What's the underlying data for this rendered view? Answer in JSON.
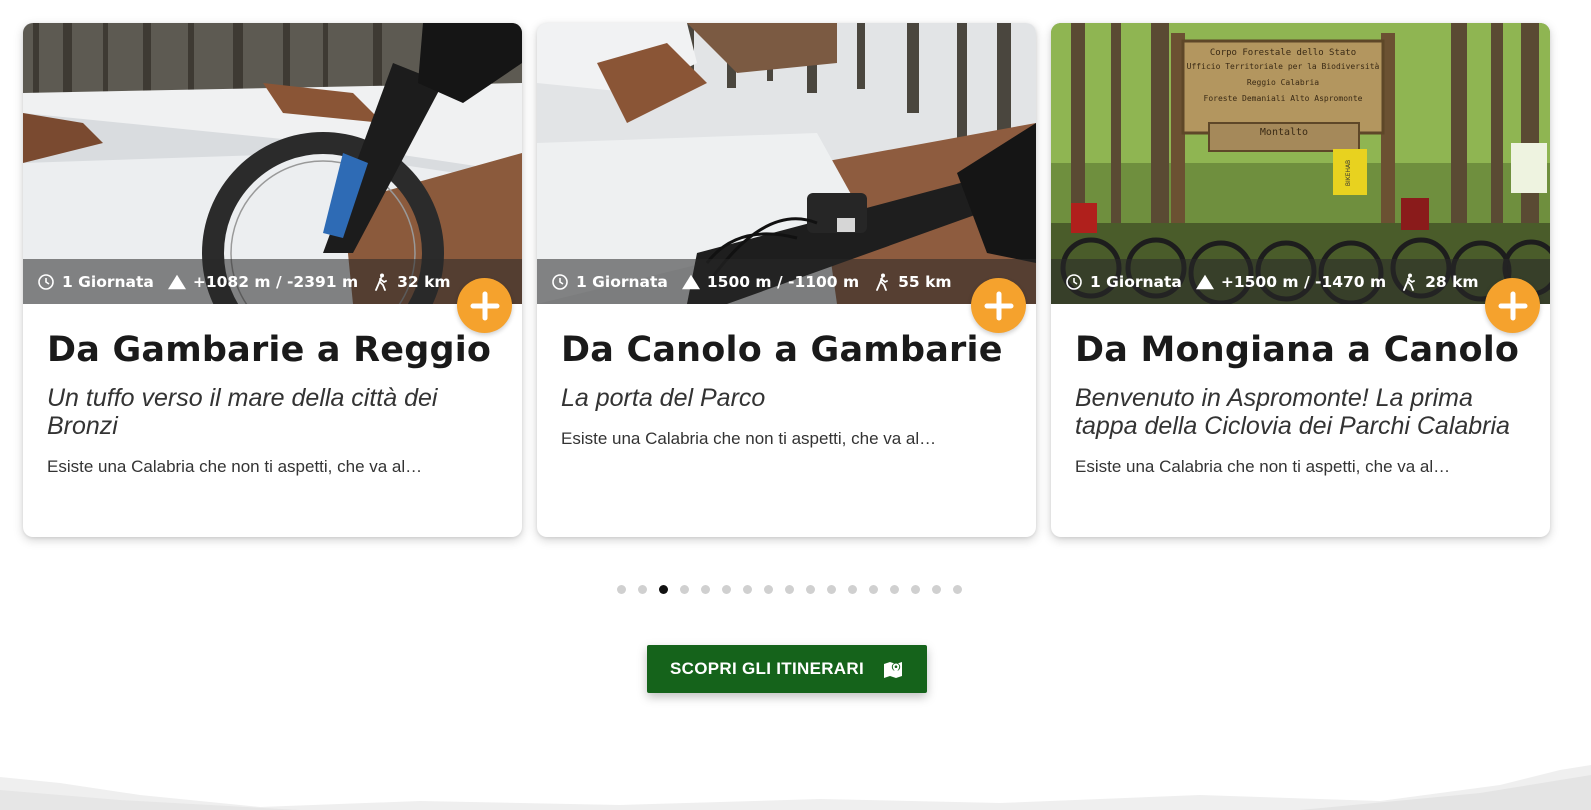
{
  "cards": [
    {
      "duration": "1 Giornata",
      "elevation": "+1082 m / -2391 m",
      "distance": "32 km",
      "title": "Da Gambarie a Reggio",
      "subtitle": "Un tuffo verso il mare della città dei Bronzi",
      "excerpt": "Esiste una Calabria che non ti aspetti, che va al…",
      "photo": "mountain-bike-front-wheel-on-snowy-forest-trail"
    },
    {
      "duration": "1 Giornata",
      "elevation": "1500 m / -1100 m",
      "distance": "55 km",
      "title": "Da Canolo a Gambarie",
      "subtitle": "La porta del Parco",
      "excerpt": "Esiste una Calabria che non ti aspetti, che va al…",
      "photo": "bike-handlebar-on-snowy-forest-trail"
    },
    {
      "duration": "1 Giornata",
      "elevation": "+1500 m / -1470 m",
      "distance": "28 km",
      "title": "Da Mongiana a Canolo",
      "subtitle": "Benvenuto in Aspromonte! La prima tappa della Ciclovia dei Parchi Calabria",
      "excerpt": "Esiste una Calabria che non ti aspetti, che va al…",
      "photo": "bicycles-parked-under-wooden-forest-sign",
      "sign": {
        "line1": "Corpo Forestale dello Stato",
        "line2": "Ufficio Territoriale per la Biodiversità",
        "line3": "Reggio Calabria",
        "line4": "Foreste Demaniali Alto Aspromonte",
        "line5": "Montalto",
        "flag": "BIKEHAB"
      }
    }
  ],
  "carousel": {
    "total_pages": 17,
    "active_index": 2
  },
  "cta": {
    "label": "SCOPRI GLI ITINERARI",
    "icon": "map-marker-icon"
  },
  "colors": {
    "accent": "#f5a22d",
    "cta_bg": "#15631b",
    "dot_active": "#111111",
    "dot_inactive": "#d0d0d0"
  },
  "icons": {
    "duration": "clock-icon",
    "elevation": "mountain-icon",
    "distance": "hiker-icon",
    "more": "plus-icon"
  }
}
